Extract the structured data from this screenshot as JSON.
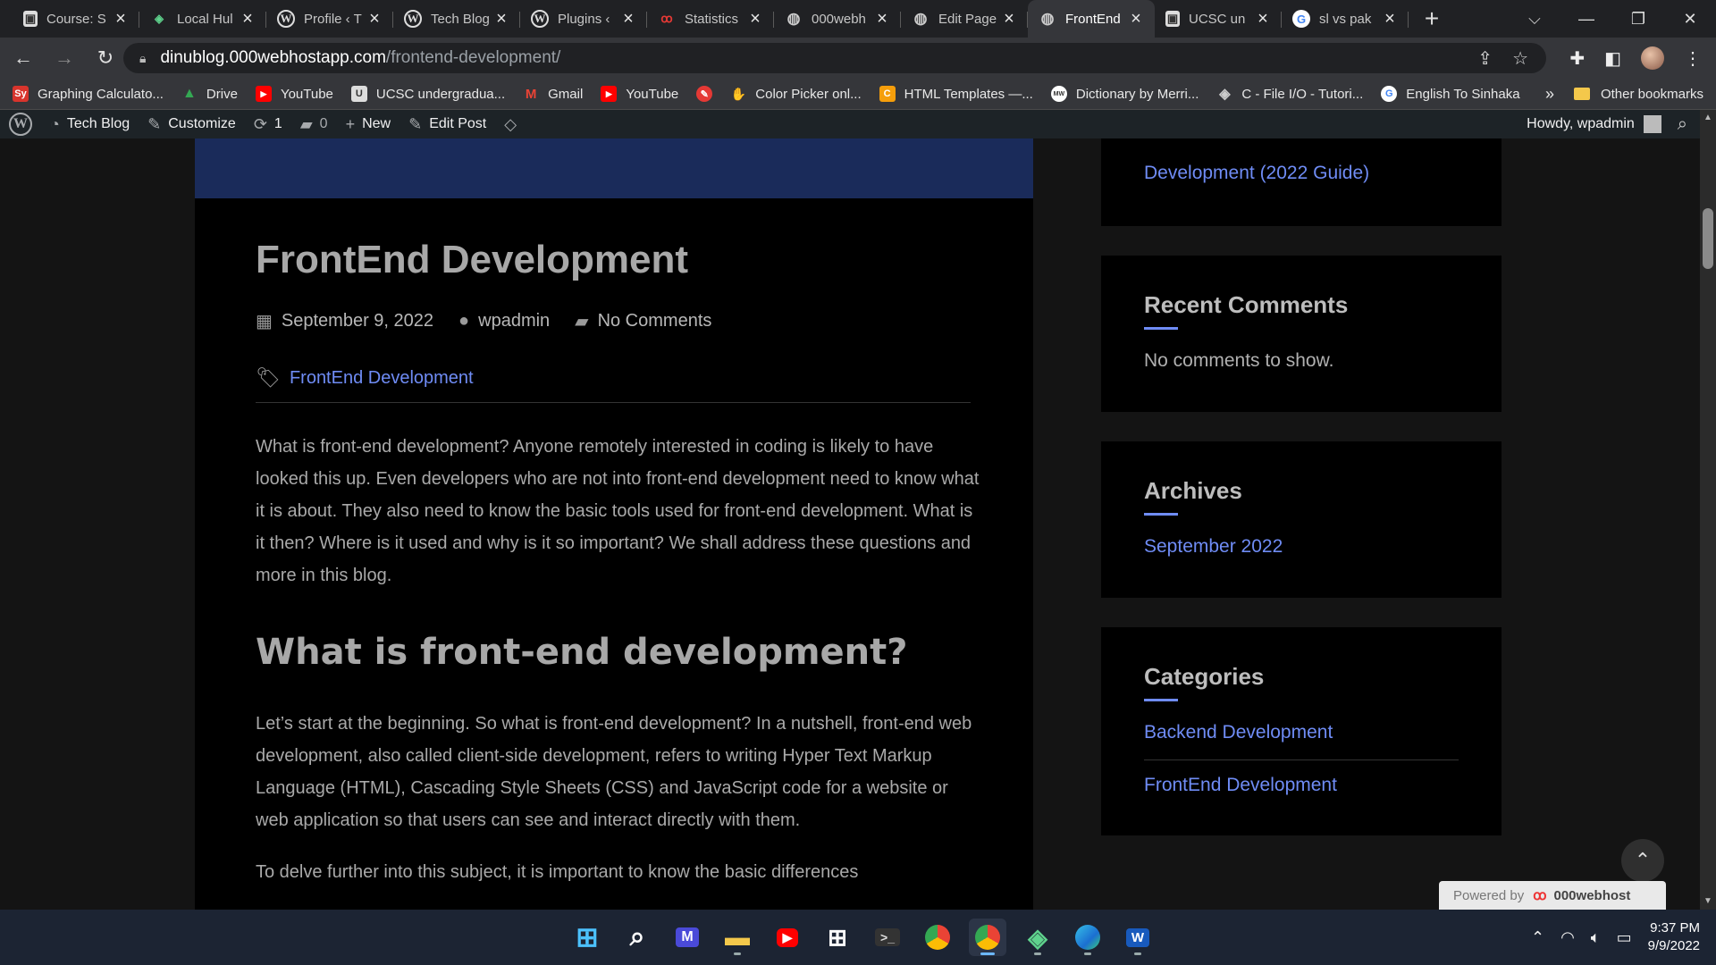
{
  "browser": {
    "tabs": [
      {
        "title": "Course: S",
        "favicon": "page-icon",
        "active": false
      },
      {
        "title": "Local Hul",
        "favicon": "localhub-icon",
        "active": false
      },
      {
        "title": "Profile ‹ T",
        "favicon": "wordpress-icon",
        "active": false
      },
      {
        "title": "Tech Blog",
        "favicon": "wordpress-icon",
        "active": false
      },
      {
        "title": "Plugins ‹",
        "favicon": "wordpress-icon",
        "active": false
      },
      {
        "title": "Statistics",
        "favicon": "000webhost-icon",
        "active": false
      },
      {
        "title": "000webh",
        "favicon": "globe-icon",
        "active": false
      },
      {
        "title": "Edit Page",
        "favicon": "globe-icon",
        "active": false
      },
      {
        "title": "FrontEnd",
        "favicon": "globe-icon",
        "active": true
      },
      {
        "title": "UCSC un",
        "favicon": "page-icon",
        "active": false
      },
      {
        "title": "sl vs pak",
        "favicon": "google-icon",
        "active": false
      }
    ],
    "address": {
      "host": "dinublog.000webhostapp.com",
      "path": "/frontend-development/"
    },
    "bookmarks": [
      {
        "label": "Graphing Calculato...",
        "icon": "sy",
        "color": "#d8342c"
      },
      {
        "label": "Drive",
        "icon": "▲",
        "color": "#34a853"
      },
      {
        "label": "YouTube",
        "icon": "▶",
        "color": "#ff0000"
      },
      {
        "label": "UCSC undergradua...",
        "icon": "U",
        "color": "#cccccc"
      },
      {
        "label": "Gmail",
        "icon": "M",
        "color": "#ea4335"
      },
      {
        "label": "YouTube",
        "icon": "▶",
        "color": "#ff0000"
      },
      {
        "label": "",
        "icon": "✎",
        "color": "#e53935"
      },
      {
        "label": "Color Picker onl...",
        "icon": "✋",
        "color": "#ffcc33"
      },
      {
        "label": "HTML Templates —...",
        "icon": "C",
        "color": "#f59e0b"
      },
      {
        "label": "Dictionary by Merri...",
        "icon": "MW",
        "color": "#ffffff"
      },
      {
        "label": "C - File I/O - Tutori...",
        "icon": "◈",
        "color": "#cccccc"
      },
      {
        "label": "English To Sinhaka",
        "icon": "G",
        "color": "#ffffff"
      }
    ],
    "bookmarks_more": "»",
    "other_bookmarks": "Other bookmarks"
  },
  "adminbar": {
    "site_name": "Tech Blog",
    "customize": "Customize",
    "updates_count": "1",
    "comments_count": "0",
    "new": "New",
    "edit_post": "Edit Post",
    "howdy": "Howdy, wpadmin"
  },
  "article": {
    "title": "FrontEnd Development",
    "date": "September 9, 2022",
    "author": "wpadmin",
    "comments": "No Comments",
    "category": "FrontEnd Development",
    "intro": "What is front-end development? Anyone remotely interested in coding is likely to have looked this up. Even developers who are not into front-end development need to know what it is about. They also need to know the basic tools used for front-end development. What is it then? Where is it used and why is it so important? We shall address these questions and more in this blog.",
    "heading": "What is front-end development?",
    "para2": "Let’s start at the beginning. So what is front-end development? In a nutshell, front-end web development, also called client-side development, refers to writing Hyper Text Markup Language (HTML), Cascading Style Sheets (CSS) and JavaScript code for a website or web application so that users can see and interact directly with them.",
    "para3": "To delve further into this subject, it is important to know the basic differences"
  },
  "sidebar": {
    "recent_posts_tail": "Development (2022 Guide)",
    "recent_comments_title": "Recent Comments",
    "recent_comments_empty": "No comments to show.",
    "archives_title": "Archives",
    "archives": [
      "September 2022"
    ],
    "categories_title": "Categories",
    "categories": [
      "Backend Development",
      "FrontEnd Development"
    ]
  },
  "footer": {
    "powered_by": "Powered by",
    "brand": "000webhost"
  },
  "taskbar": {
    "time": "9:37 PM",
    "date": "9/9/2022"
  },
  "colors": {
    "link": "#6f8cf5",
    "banner": "#1a2b5a",
    "adminbar": "#1d2327"
  }
}
